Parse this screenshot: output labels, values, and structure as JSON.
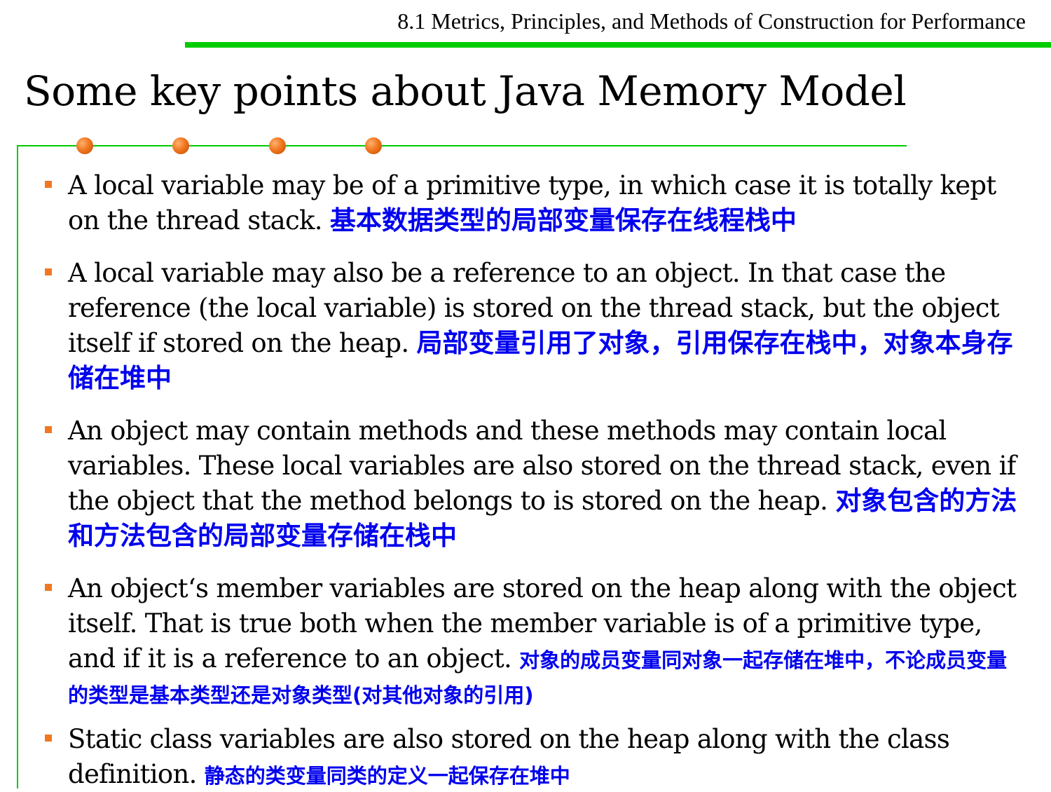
{
  "header": {
    "section": "8.1 Metrics, Principles, and Methods of Construction for Performance"
  },
  "slide": {
    "title": "Some key points about Java Memory Model"
  },
  "bullets": [
    {
      "en": "A local variable may be of a primitive type, in which case it is totally kept on the thread stack.",
      "zh": "基本数据类型的局部变量保存在线程栈中"
    },
    {
      "en": "A local variable may also be a reference to an object. In that case the reference (the local variable) is stored on the thread stack, but the object itself if stored on the heap.",
      "zh": "局部变量引用了对象，引用保存在栈中，对象本身存储在堆中"
    },
    {
      "en": "An object may contain methods and these methods may contain local variables. These local variables are also stored on the thread stack, even if the object that the method belongs to is stored on the heap.",
      "zh": "对象包含的方法和方法包含的局部变量存储在栈中"
    },
    {
      "en": "An object‘s member variables are stored on the heap along with the object itself. That is true both when the member variable is of a primitive type, and if it is a reference to an object.",
      "zh": "对象的成员变量同对象一起存储在堆中，不论成员变量的类型是基本类型还是对象类型(对其他对象的引用)"
    },
    {
      "en": "Static class variables are also stored on the heap along with the class definition.",
      "zh": "静态的类变量同类的定义一起保存在堆中"
    }
  ],
  "colors": {
    "accent_green": "#00cc00",
    "bullet_orange": "#f07820",
    "translation_blue": "#0000ee"
  }
}
